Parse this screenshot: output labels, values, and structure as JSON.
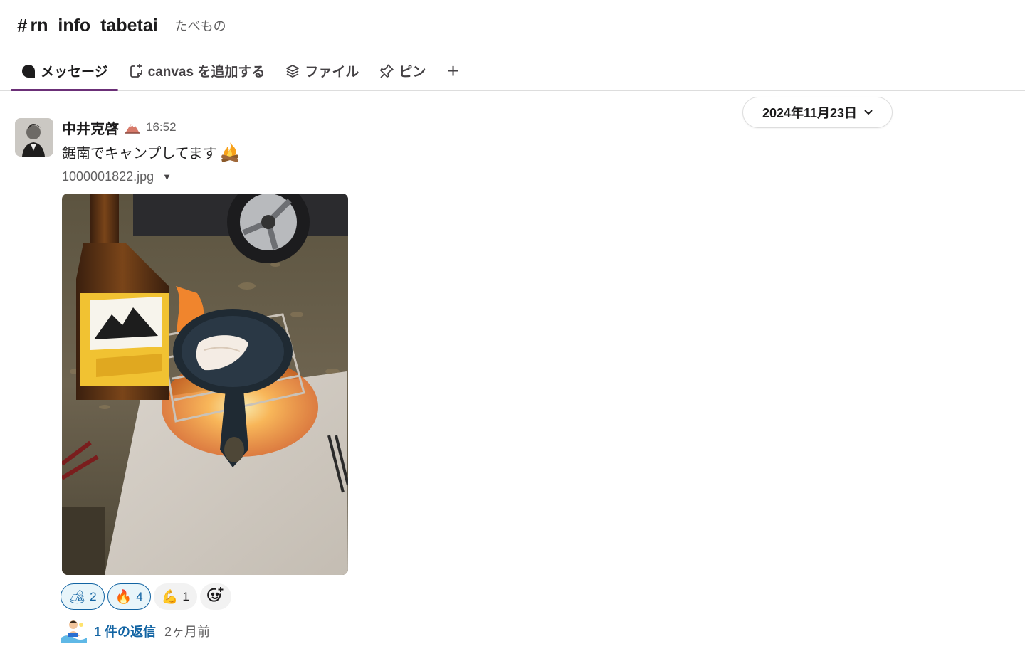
{
  "channel": {
    "hash": "#",
    "name": "rn_info_tabetai",
    "topic": "たべもの"
  },
  "tabs": [
    {
      "label": "メッセージ",
      "icon": "message-bubble-icon",
      "active": true
    },
    {
      "label": "canvas を追加する",
      "icon": "canvas-add-icon",
      "active": false
    },
    {
      "label": "ファイル",
      "icon": "files-layers-icon",
      "active": false
    },
    {
      "label": "ピン",
      "icon": "pin-icon",
      "active": false
    }
  ],
  "tab_add": "+",
  "date_divider": "2024年11月23日",
  "message": {
    "author": "中井克啓",
    "status_emoji": "mountain-icon",
    "time": "16:52",
    "text": "鋸南でキャンプしてます",
    "text_emoji": "campfire-icon",
    "file_name": "1000001822.jpg",
    "image_alt": "campfire skillet photo"
  },
  "reactions": [
    {
      "emoji": "🏕",
      "count": "2",
      "mine": true
    },
    {
      "emoji": "🔥",
      "count": "4",
      "mine": true
    },
    {
      "emoji": "💪",
      "count": "1",
      "mine": false
    }
  ],
  "thread": {
    "reply_count": "1 件の返信",
    "last_reply": "2ヶ月前"
  },
  "colors": {
    "accent": "#6b2f77",
    "link": "#1264a3",
    "muted": "#616061"
  }
}
